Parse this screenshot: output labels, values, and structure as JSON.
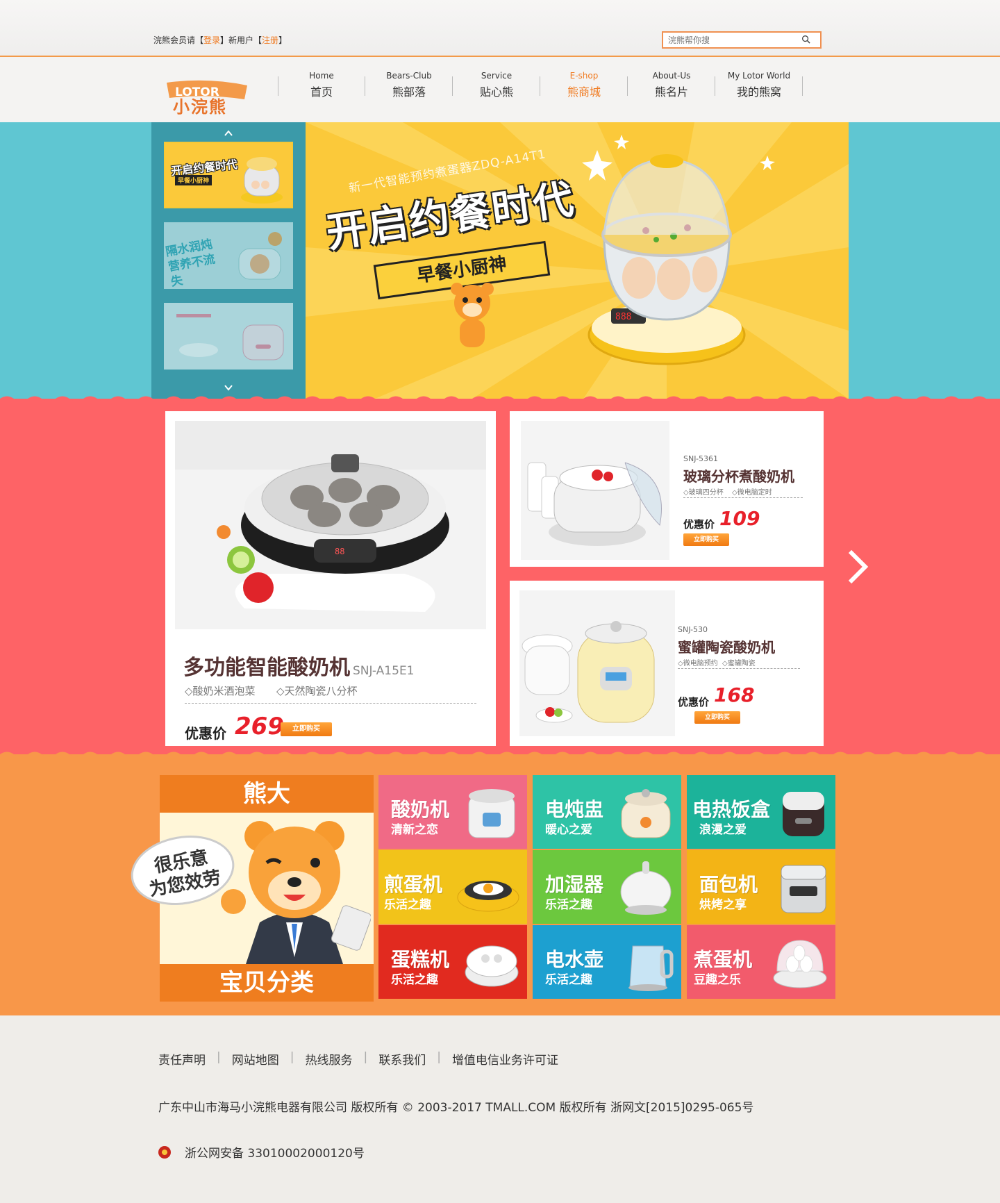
{
  "topbar": {
    "login_prefix": "浣熊会员请【",
    "login_link": "登录",
    "login_mid": "】新用户【",
    "register_link": "注册",
    "login_suffix": "】",
    "search_placeholder": "浣熊帮你搜"
  },
  "logo": {
    "brand_en": "LOTOR",
    "brand_cn": "小浣熊"
  },
  "nav": [
    {
      "en": "Home",
      "cn": "首页"
    },
    {
      "en": "Bears-Club",
      "cn": "熊部落"
    },
    {
      "en": "Service",
      "cn": "贴心熊"
    },
    {
      "en": "E-shop",
      "cn": "熊商城"
    },
    {
      "en": "About-Us",
      "cn": "熊名片"
    },
    {
      "en": "My Lotor World",
      "cn": "我的熊窝"
    }
  ],
  "hero": {
    "subtitle": "新一代智能预约煮蛋器ZDQ-A14T1",
    "title": "开启约餐时代",
    "ribbon": "早餐小厨神",
    "thumb1_title": "开启约餐时代",
    "thumb1_sub": "早餐小厨神",
    "thumb2_title": "隔水润炖 营养不流失"
  },
  "products": {
    "main": {
      "name": "多功能智能酸奶机",
      "model": "SNJ-A15E1",
      "feat1": "◇酸奶米酒泡菜",
      "feat2": "◇天然陶瓷八分杯",
      "price_label": "优惠价",
      "price": "269",
      "buy": "立即购买"
    },
    "p2": {
      "model": "SNJ-5361",
      "name": "玻璃分杯煮酸奶机",
      "feat1": "◇玻璃四分杯",
      "feat2": "◇微电脑定时",
      "price_label": "优惠价",
      "price": "109",
      "buy": "立即购买"
    },
    "p3": {
      "model": "SNJ-530",
      "name": "蜜罐陶瓷酸奶机",
      "feat1": "◇微电脑预约",
      "feat2": "◇蜜罐陶瓷",
      "price_label": "优惠价",
      "price": "168",
      "buy": "立即购买"
    }
  },
  "categories": {
    "panel_top": "熊大",
    "bubble_line1": "很乐意",
    "bubble_line2": "为您效劳",
    "panel_bottom": "宝贝分类",
    "items": [
      {
        "name": "酸奶机",
        "sub": "清新之恋",
        "color": "#f06a86"
      },
      {
        "name": "电炖盅",
        "sub": "暖心之爱",
        "color": "#2ec3a6"
      },
      {
        "name": "电热饭盒",
        "sub": "浪漫之爱",
        "color": "#1cb39a"
      },
      {
        "name": "煎蛋机",
        "sub": "乐活之趣",
        "color": "#f2c31a"
      },
      {
        "name": "加湿器",
        "sub": "乐活之趣",
        "color": "#6cc83e"
      },
      {
        "name": "面包机",
        "sub": "烘烤之享",
        "color": "#f3b416"
      },
      {
        "name": "蛋糕机",
        "sub": "乐活之趣",
        "color": "#e12a1f"
      },
      {
        "name": "电水壶",
        "sub": "乐活之趣",
        "color": "#1da0d0"
      },
      {
        "name": "煮蛋机",
        "sub": "豆趣之乐",
        "color": "#f25b6c"
      }
    ]
  },
  "footer": {
    "links": [
      "责任声明",
      "网站地图",
      "热线服务",
      "联系我们",
      "增值电信业务许可证"
    ],
    "copyright": "广东中山市海马小浣熊电器有限公司 版权所有 © 2003-2017 TMALL.COM 版权所有 浙网文[2015]0295-065号",
    "record": "浙公网安备 33010002000120号"
  },
  "colors": {
    "accent": "#f07a20",
    "teal": "#5fc6d2",
    "red": "#fe6366",
    "orange": "#f89749"
  }
}
